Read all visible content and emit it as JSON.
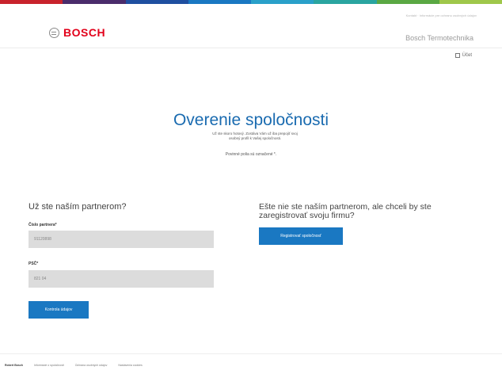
{
  "topbar_colors": [
    "#c8232c",
    "#4a2c6b",
    "#1f4fa0",
    "#1a78c2",
    "#29a0c9",
    "#2aa5a0",
    "#5aa843",
    "#9fc74a"
  ],
  "header": {
    "utility_links": "Kontakt · Informácie pre ochranu osobných údajov",
    "logo_text": "BOSCH",
    "brand_sub": "Bosch Termotechnika",
    "login_label": "Účet"
  },
  "main": {
    "title": "Overenie spoločnosti",
    "intro": "Už ste skoro hotový. Zostáva Vám už iba prepojiť svoj osobný profil k Vašej spoločnosti.",
    "required_note": "Povinné polia sú označené *."
  },
  "left": {
    "heading": "Už ste naším partnerom?",
    "partner_label": "Číslo partnera*",
    "partner_value": "91120898",
    "psc_label": "PSČ*",
    "psc_value": "821 04",
    "verify_button": "Kontrola údajov"
  },
  "right": {
    "heading": "Ešte nie ste naším partnerom, ale chceli by ste zaregistrovať svoju firmu?",
    "register_button": "Registrovať spoločnosť"
  },
  "footer": {
    "brand": "Robert Bosch",
    "links": [
      "Informácie o spoločnosti",
      "Ochrana osobných údajov",
      "Nastavenia cookies"
    ]
  }
}
